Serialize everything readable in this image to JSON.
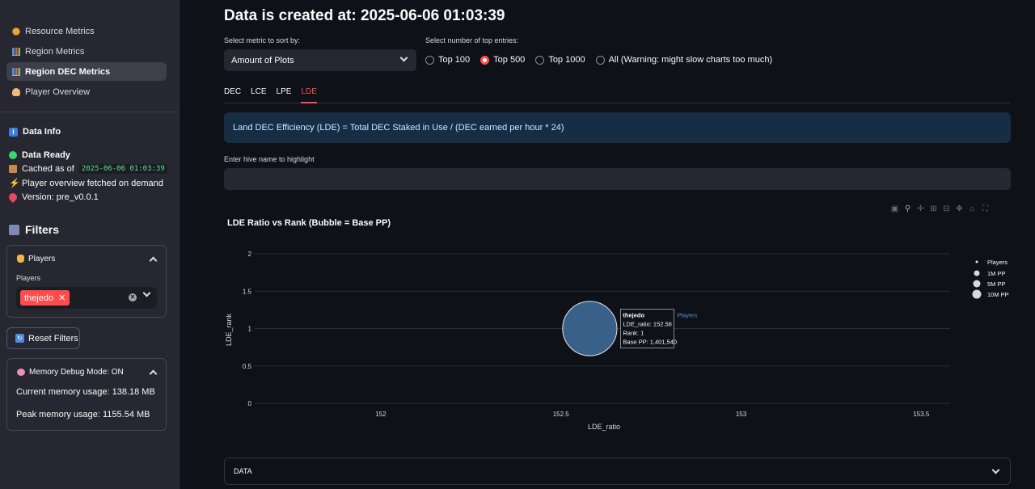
{
  "sidebar": {
    "nav": [
      {
        "label": "Resource Metrics",
        "icon": "coin-icon",
        "active": false
      },
      {
        "label": "Region Metrics",
        "icon": "bar-chart-icon",
        "active": false
      },
      {
        "label": "Region DEC Metrics",
        "icon": "bar-chart-icon",
        "active": true
      },
      {
        "label": "Player Overview",
        "icon": "person-icon",
        "active": false
      }
    ],
    "data_info": {
      "title": "Data Info",
      "status": "Data Ready",
      "cached_label": "Cached as of",
      "cached_value": "2025-06-06 01:03:39",
      "fetch_note": "Player overview fetched on demand",
      "version": "Version: pre_v0.0.1"
    },
    "filters": {
      "title": "Filters",
      "players_card": {
        "header": "Players",
        "field_label": "Players",
        "selected": [
          "thejedo"
        ]
      },
      "reset_button": "Reset Filters",
      "memory_card": {
        "header": "Memory Debug Mode: ON",
        "current": "Current memory usage: 138.18 MB",
        "peak": "Peak memory usage: 1155.54 MB"
      }
    }
  },
  "main": {
    "title": "Data is created at: 2025-06-06 01:03:39",
    "sort_label": "Select metric to sort by:",
    "sort_value": "Amount of Plots",
    "top_label": "Select number of top entries:",
    "top_options": [
      {
        "label": "Top 100",
        "selected": false
      },
      {
        "label": "Top 500",
        "selected": true
      },
      {
        "label": "Top 1000",
        "selected": false
      },
      {
        "label": "All (Warning: might slow charts too much)",
        "selected": false
      }
    ],
    "tabs": [
      {
        "label": "DEC",
        "active": false
      },
      {
        "label": "LCE",
        "active": false
      },
      {
        "label": "LPE",
        "active": false
      },
      {
        "label": "LDE",
        "active": true
      }
    ],
    "info_text": "Land DEC Efficiency (LDE) = Total DEC Staked in Use / (DEC earned per hour * 24)",
    "highlight_label": "Enter hive name to highlight",
    "highlight_value": "",
    "data_expander": "DATA"
  },
  "chart_data": {
    "type": "scatter",
    "title": "LDE Ratio vs Rank (Bubble = Base PP)",
    "xlabel": "LDE_ratio",
    "ylabel": "LDE_rank",
    "xlim": [
      151.65,
      153.58
    ],
    "ylim": [
      0,
      2
    ],
    "x_ticks": [
      "152",
      "152.5",
      "153",
      "153.5"
    ],
    "y_ticks": [
      "0",
      "0.5",
      "1",
      "1.5",
      "2"
    ],
    "series": [
      {
        "name": "Players",
        "color": "#3f6e9e",
        "points": [
          {
            "label": "thejedo",
            "x": 152.58,
            "y": 1,
            "size": 1401540,
            "rank": 1
          }
        ]
      }
    ],
    "hover": {
      "title": "thejedo",
      "lines": [
        "LDE_ratio: 152.58",
        "Rank: 1",
        "Base PP: 1,401,540"
      ],
      "series": "Players"
    },
    "legend": {
      "title": "Players",
      "items": [
        "1M PP",
        "5M PP",
        "10M PP"
      ],
      "placement": "right"
    }
  }
}
